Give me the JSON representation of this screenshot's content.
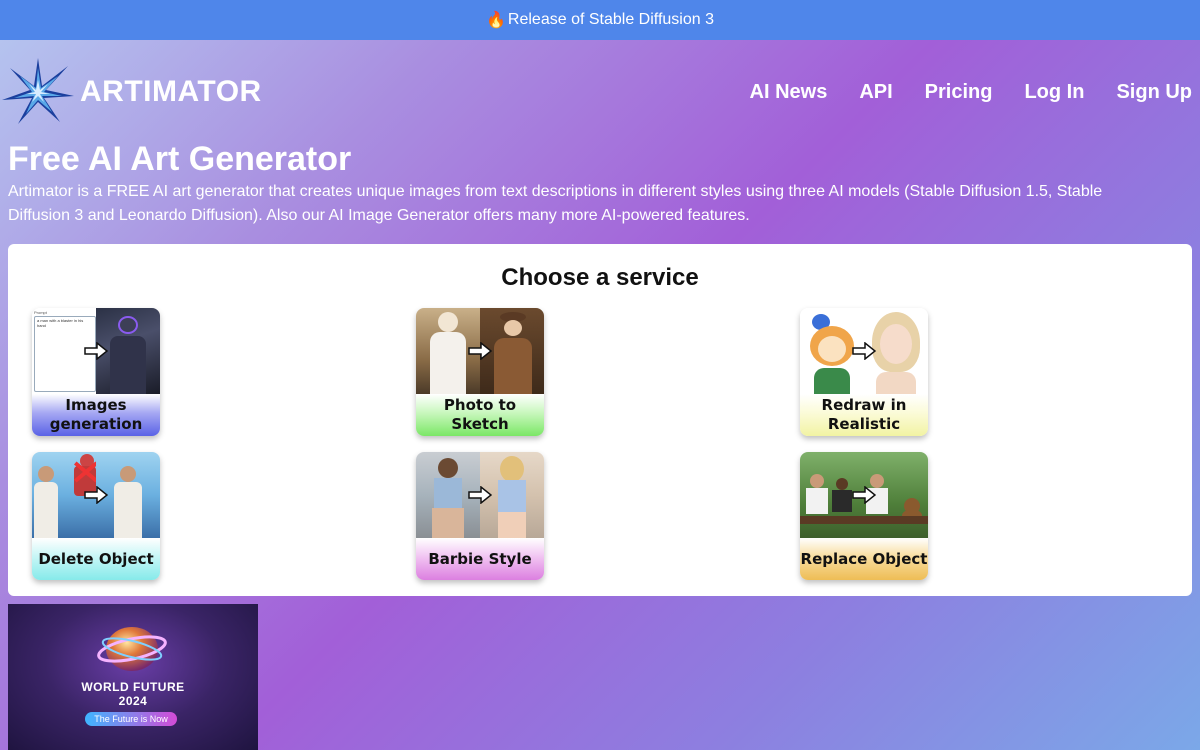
{
  "announcement": {
    "icon": "fire-icon",
    "emoji": "🔥",
    "text": "Release of Stable Diffusion 3"
  },
  "brand": {
    "name": "ARTIMATOR",
    "logo_icon": "starburst-logo-icon"
  },
  "nav": {
    "items": [
      {
        "label": "AI News"
      },
      {
        "label": "API"
      },
      {
        "label": "Pricing"
      },
      {
        "label": "Log In"
      },
      {
        "label": "Sign Up"
      }
    ]
  },
  "hero": {
    "title": "Free AI Art Generator",
    "description": "Artimator is a FREE AI art generator that creates unique images from text descriptions in different styles using three AI models (Stable Diffusion 1.5, Stable Diffusion 3 and Leonardo Diffusion). Also our AI Image Generator offers many more AI-powered features."
  },
  "services": {
    "title": "Choose a service",
    "items": [
      {
        "label": "Images generation",
        "label_color": "#7e86ee",
        "thumb_text_title": "Prompt",
        "thumb_text": "a man with a blaster in his hand"
      },
      {
        "label": "Photo to Sketch",
        "label_color": "#9ff08c"
      },
      {
        "label": "Redraw in Realistic",
        "label_color": "#f6f7b5"
      },
      {
        "label": "Delete Object",
        "label_color": "#9ef0f0"
      },
      {
        "label": "Barbie Style",
        "label_color": "#e69ae8"
      },
      {
        "label": "Replace Object",
        "label_color": "#f2c56a"
      }
    ]
  },
  "promo_banner": {
    "title_line1": "WORLD FUTURE",
    "title_line2": "2024",
    "pill": "The Future is Now"
  },
  "colors": {
    "announcement_bg": "#4f86ea",
    "card_bg": "#ffffff"
  }
}
